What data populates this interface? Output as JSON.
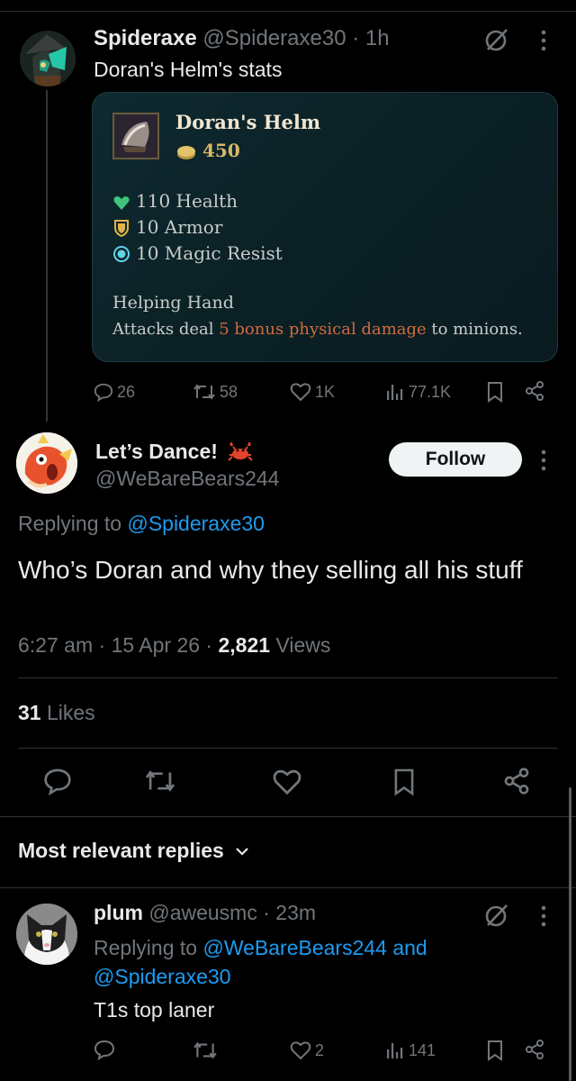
{
  "tweet1": {
    "name": "Spideraxe",
    "handle": "@Spideraxe30",
    "time": "· 1h",
    "text": "Doran's Helm's stats",
    "card": {
      "item_name": "Doran's Helm",
      "price": "450",
      "stats": [
        "110 Health",
        "10 Armor",
        "10 Magic Resist"
      ],
      "passive_name": "Helping Hand",
      "desc_prefix": "Attacks deal ",
      "desc_highlight": "5 bonus physical damage",
      "desc_suffix": " to minions."
    },
    "actions": {
      "replies": "26",
      "reposts": "58",
      "likes": "1K",
      "views": "77.1K"
    }
  },
  "tweet2": {
    "name": "Let’s Dance!",
    "handle": "@WeBareBears244",
    "follow_label": "Follow",
    "replying_prefix": "Replying to ",
    "replying_to": "@Spideraxe30",
    "text": "Who’s Doran and why they selling all his stuff",
    "time": "6:27 am",
    "date": "15 Apr 26",
    "views_count": "2,821",
    "views_label": "Views",
    "likes_count": "31",
    "likes_label": "Likes"
  },
  "sort_label": "Most relevant replies",
  "reply": {
    "name": "plum",
    "handle": "@aweusmc",
    "time": "· 23m",
    "replying_prefix": "Replying to ",
    "replying_to_1": "@WeBareBears244",
    "replying_and": " and",
    "replying_to_2": "@Spideraxe30",
    "text": "T1s top laner",
    "actions": {
      "likes": "2",
      "views": "141"
    }
  },
  "colors": {
    "accent": "#1d9bf0",
    "muted": "#71767b",
    "background": "#000000",
    "highlight": "#d36a3d",
    "gold": "#d9b967"
  }
}
